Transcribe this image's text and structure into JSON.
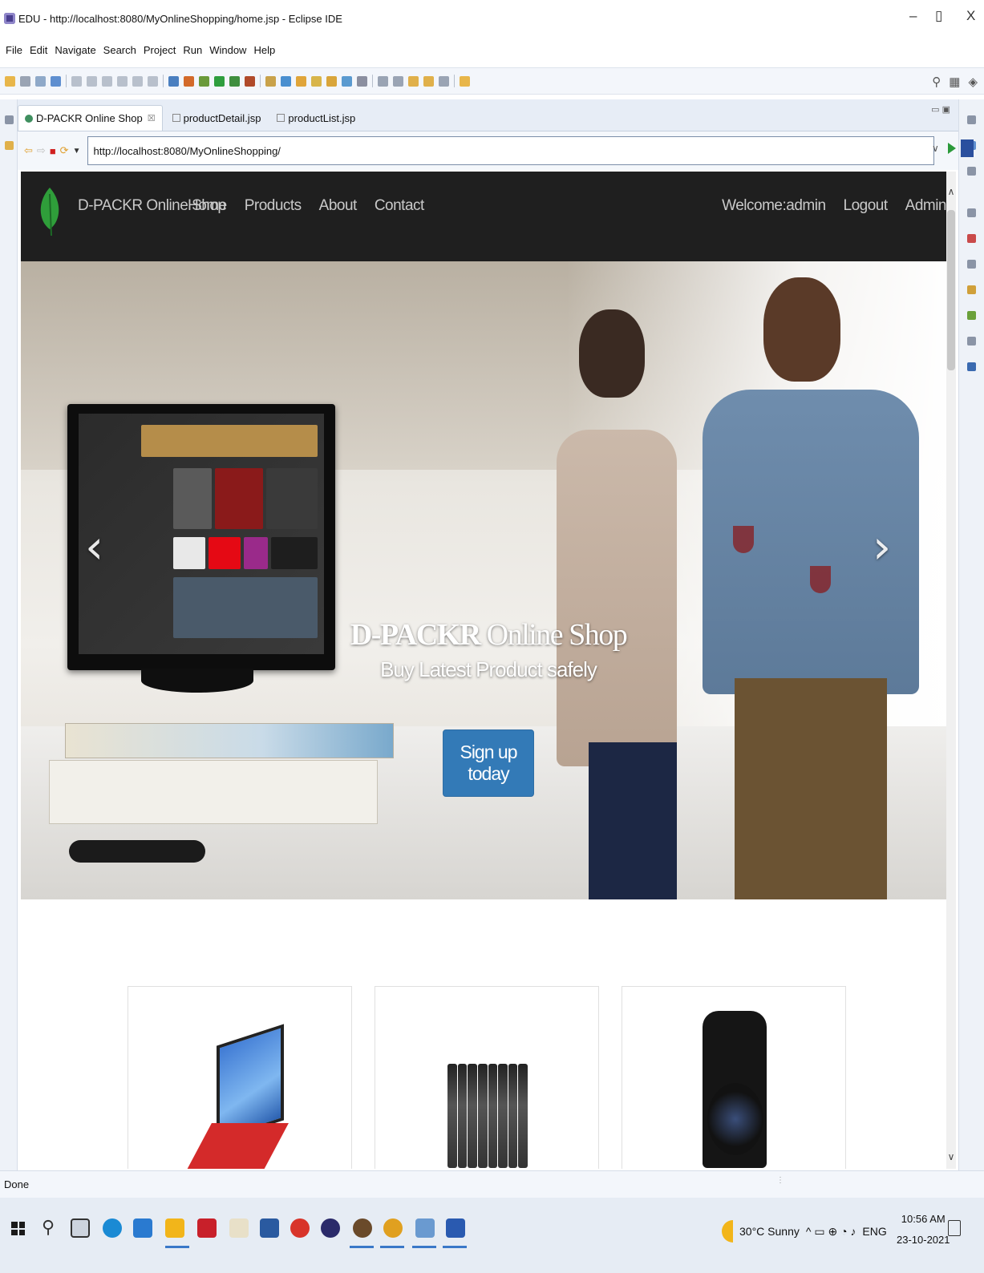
{
  "window": {
    "title": "EDU - http://localhost:8080/MyOnlineShopping/home.jsp - Eclipse IDE",
    "minimize": "–",
    "maximize": "▯",
    "close": "X"
  },
  "menu": [
    "File",
    "Edit",
    "Navigate",
    "Search",
    "Project",
    "Run",
    "Window",
    "Help"
  ],
  "tabs": [
    {
      "label": "D-PACKR Online Shop",
      "active": true,
      "close": "☒"
    },
    {
      "label": "productDetail.jsp",
      "active": false
    },
    {
      "label": "productList.jsp",
      "active": false
    }
  ],
  "browser": {
    "url": "http://localhost:8080/MyOnlineShopping/"
  },
  "site": {
    "brand": "D-PACKR Online Shop",
    "nav": [
      "Home",
      "Products",
      "About",
      "Contact"
    ],
    "nav_right": [
      "Welcome:admin",
      "Logout",
      "Admin"
    ],
    "hero": {
      "heading_bold": "D-PACKR",
      "heading_rest": " Online Shop",
      "subheading": "Buy Latest Product safely",
      "button": "Sign up today",
      "prev": "‹",
      "next": "›"
    },
    "products": [
      {
        "icon": "laptop-image"
      },
      {
        "icon": "phones-image"
      },
      {
        "icon": "camera-image"
      }
    ]
  },
  "status": {
    "text": "Done"
  },
  "taskbar": {
    "weather": "30°C  Sunny",
    "tray_icons": "^  ▭  ⊕  ◔  ♪",
    "language": "ENG",
    "time": "10:56 AM",
    "date": "23-10-2021"
  },
  "colors": {
    "navbar": "#1f1f1f",
    "primary_button": "#337ab7",
    "leaf": "#2f9e3a"
  }
}
